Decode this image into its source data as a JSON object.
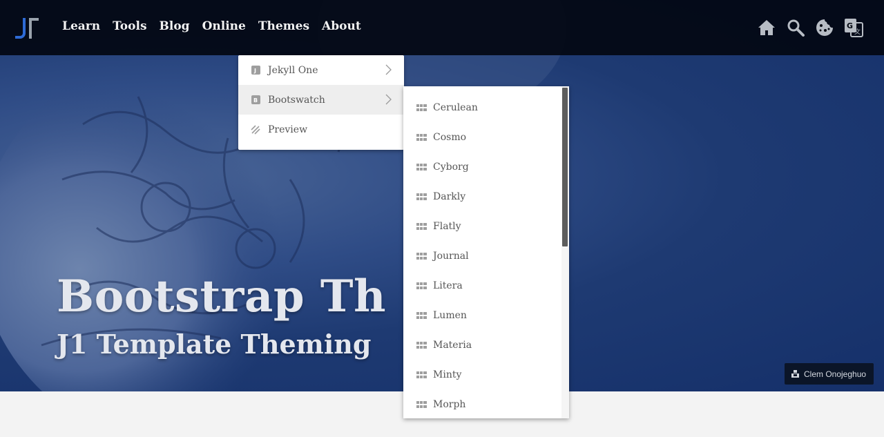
{
  "navbar": {
    "links": [
      "Learn",
      "Tools",
      "Blog",
      "Online",
      "Themes",
      "About"
    ],
    "icons": [
      "home-icon",
      "search-icon",
      "cookie-icon",
      "translate-icon"
    ]
  },
  "hero": {
    "title": "Bootstrap Th",
    "subtitle": "J1 Template Theming",
    "credit": "Clem Onojeghuo"
  },
  "themes_menu": {
    "items": [
      {
        "label": "Jekyll One",
        "icon": "jekyll-badge-icon",
        "badge": "J",
        "has_submenu": true
      },
      {
        "label": "Bootswatch",
        "icon": "bootswatch-badge-icon",
        "badge": "B",
        "has_submenu": true,
        "active": true
      },
      {
        "label": "Preview",
        "icon": "palette-icon",
        "has_submenu": false
      }
    ]
  },
  "bootswatch_menu": {
    "items": [
      "Cerulean",
      "Cosmo",
      "Cyborg",
      "Darkly",
      "Flatly",
      "Journal",
      "Litera",
      "Lumen",
      "Materia",
      "Minty",
      "Morph"
    ]
  },
  "colors": {
    "navbar": "#030812",
    "hero_blue": "#1e3a72",
    "hero_text": "#e4e7ee",
    "brand_blue": "#2e6bd6",
    "menu_active": "#eeeeee"
  }
}
